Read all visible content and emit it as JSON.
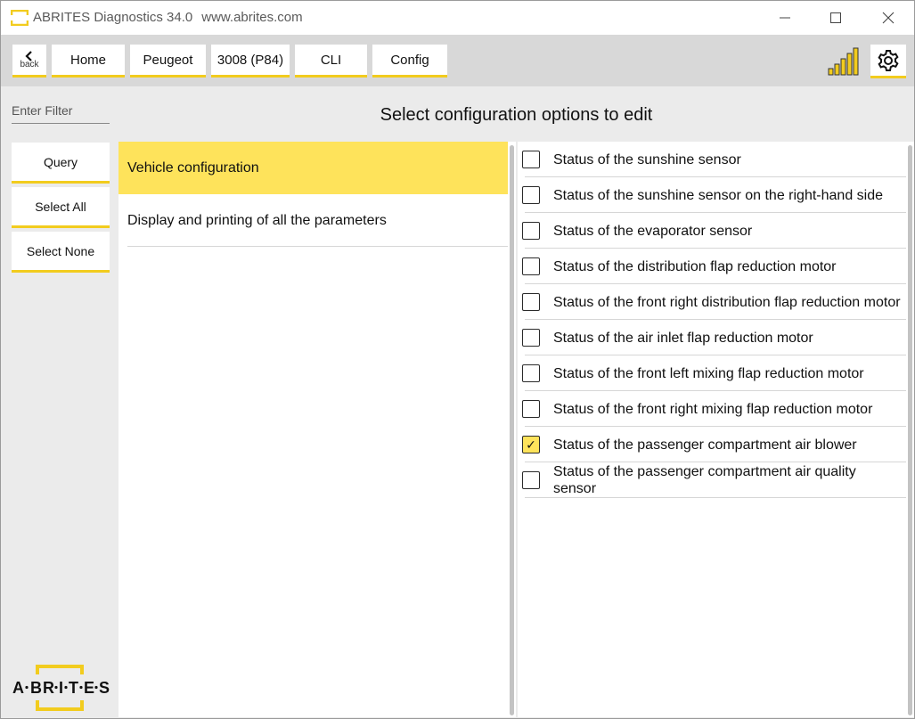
{
  "window": {
    "title": "ABRITES Diagnostics 34.0",
    "url": "www.abrites.com"
  },
  "toolbar": {
    "back_label": "back",
    "crumbs": [
      {
        "label": "Home"
      },
      {
        "label": "Peugeot"
      },
      {
        "label": "3008 (P84)"
      },
      {
        "label": "CLI"
      },
      {
        "label": "Config"
      }
    ],
    "signal_bars_active": 5
  },
  "sidebar": {
    "filter_placeholder": "Enter Filter",
    "buttons": [
      {
        "label": "Query"
      },
      {
        "label": "Select All"
      },
      {
        "label": "Select None"
      }
    ],
    "brand_text": "ABRITES"
  },
  "main": {
    "heading": "Select configuration options to edit",
    "categories": [
      {
        "label": "Vehicle configuration",
        "selected": true
      },
      {
        "label": "Display and printing of all the parameters",
        "selected": false
      }
    ],
    "options": [
      {
        "label": "Status of the sunshine sensor",
        "checked": false
      },
      {
        "label": "Status of the sunshine sensor on the right-hand side",
        "checked": false
      },
      {
        "label": "Status of the evaporator sensor",
        "checked": false
      },
      {
        "label": "Status of the distribution flap reduction motor",
        "checked": false
      },
      {
        "label": "Status of the front right distribution flap reduction motor",
        "checked": false
      },
      {
        "label": "Status of the air inlet flap reduction motor",
        "checked": false
      },
      {
        "label": "Status of the front left mixing flap reduction motor",
        "checked": false
      },
      {
        "label": "Status of the front right mixing flap reduction motor",
        "checked": false
      },
      {
        "label": "Status of the passenger compartment air blower",
        "checked": true
      },
      {
        "label": "Status of the passenger compartment air quality sensor",
        "checked": false
      }
    ]
  },
  "colors": {
    "accent": "#f2cc1e",
    "highlight": "#fee35b",
    "panel_bg": "#ebebeb",
    "toolbar_bg": "#d8d8d8"
  }
}
